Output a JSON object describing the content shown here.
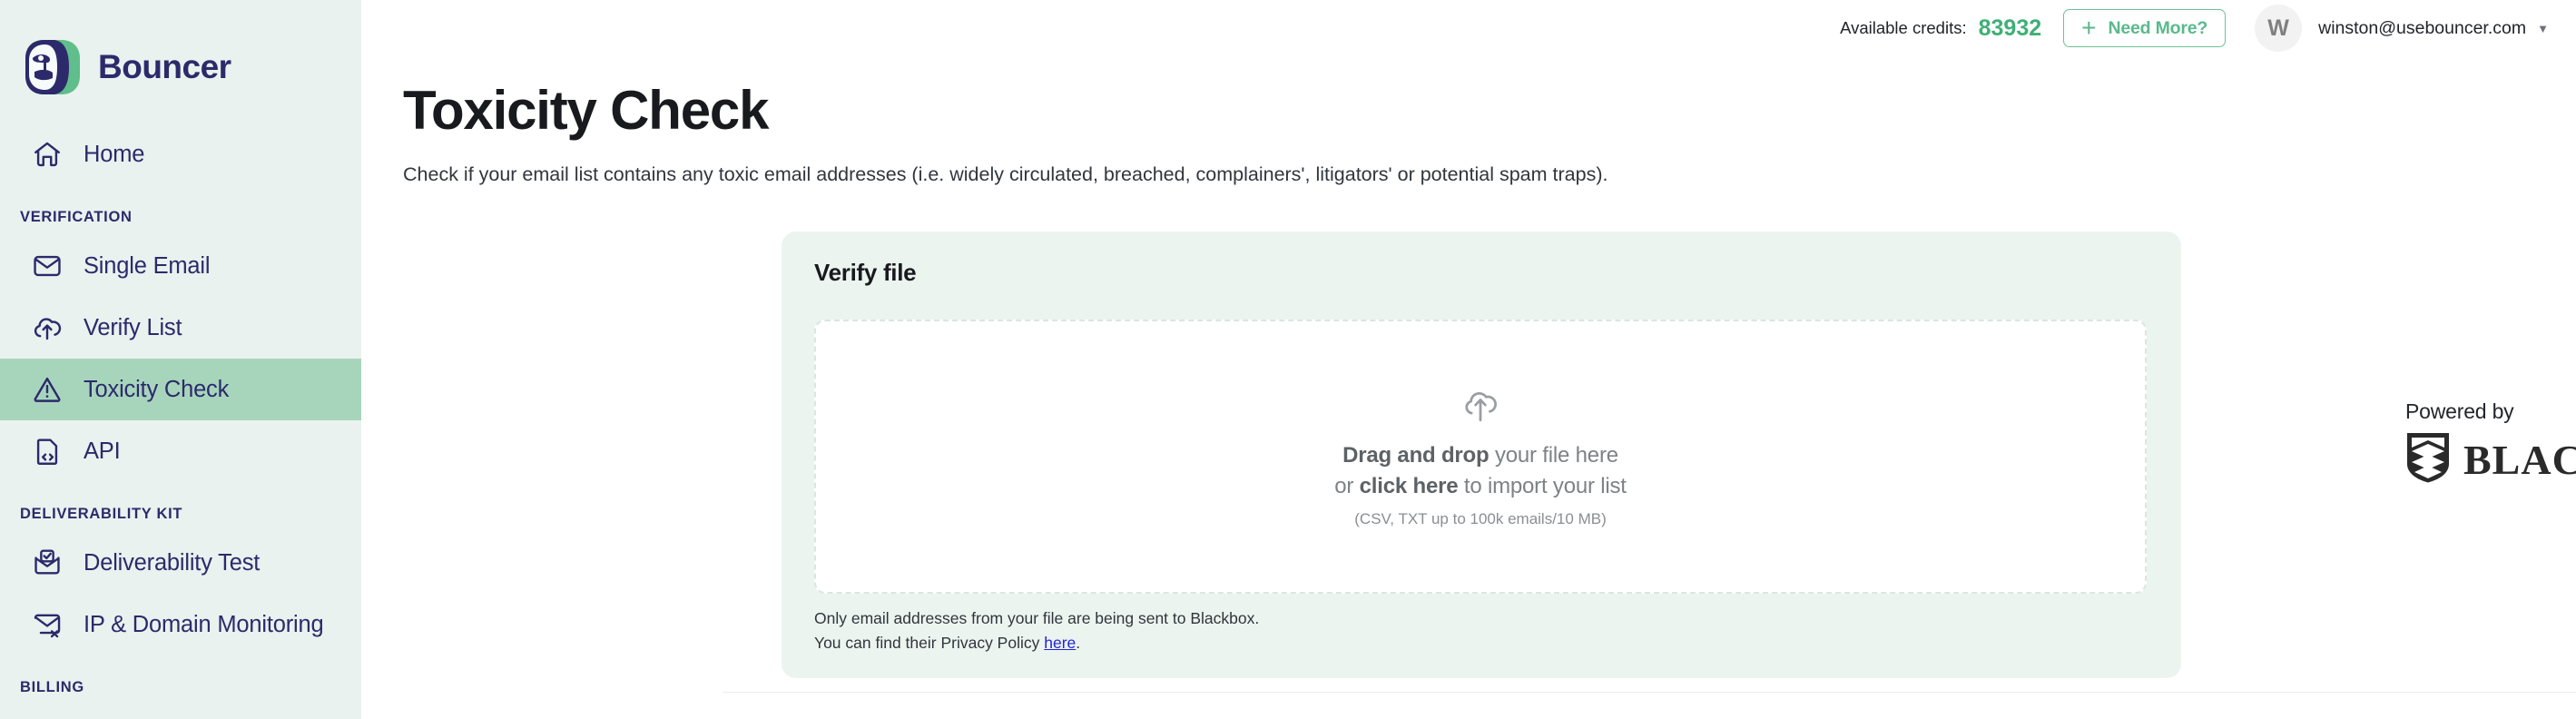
{
  "brand": {
    "name": "Bouncer",
    "logo_icon": "bouncer-gorilla-logo"
  },
  "sidebar": {
    "groups": [
      {
        "label": "",
        "items": [
          {
            "label": "Home",
            "icon": "home-icon",
            "active": false
          }
        ]
      },
      {
        "label": "VERIFICATION",
        "items": [
          {
            "label": "Single Email",
            "icon": "envelope-icon",
            "active": false
          },
          {
            "label": "Verify List",
            "icon": "cloud-upload-icon",
            "active": false
          },
          {
            "label": "Toxicity Check",
            "icon": "warning-triangle-icon",
            "active": true
          },
          {
            "label": "API",
            "icon": "code-file-icon",
            "active": false
          }
        ]
      },
      {
        "label": "DELIVERABILITY KIT",
        "items": [
          {
            "label": "Deliverability Test",
            "icon": "envelope-check-icon",
            "active": false
          },
          {
            "label": "IP & Domain Monitoring",
            "icon": "envelope-x-icon",
            "active": false
          }
        ]
      },
      {
        "label": "BILLING",
        "items": []
      }
    ]
  },
  "topbar": {
    "credits_label": "Available credits:",
    "credits_value": "83932",
    "need_more_label": "Need More?",
    "need_more_icon": "plus-icon",
    "avatar_initial": "W",
    "account_email": "winston@usebouncer.com",
    "caret_icon": "chevron-down-icon"
  },
  "page": {
    "title": "Toxicity Check",
    "subtitle": "Check if your email list contains any toxic email addresses (i.e. widely circulated, breached, complainers', litigators' or potential spam traps)."
  },
  "card": {
    "title": "Verify file",
    "dropzone": {
      "icon": "cloud-upload-icon",
      "line1_bold": "Drag and drop",
      "line1_rest": " your file here",
      "line2_prefix": "or ",
      "line2_bold": "click here",
      "line2_rest": " to import your list",
      "hint": "(CSV, TXT up to 100k emails/10 MB)"
    },
    "note_line1": "Only email addresses from your file are being sent to Blackbox.",
    "note_line2_prefix": "You can find their Privacy Policy ",
    "note_link": "here",
    "note_line2_suffix": "."
  },
  "powered_by": {
    "label": "Powered by",
    "logo_icon": "blackbox-shield-icon",
    "word": "BLACKBOX"
  },
  "colors": {
    "sidebar_bg": "#E9F2EE",
    "active_item_bg": "#A7D5BC",
    "brand_navy": "#2C2A6B",
    "accent_green": "#5BB98C",
    "credits_green": "#3FAF76",
    "card_bg": "#ECF4F0",
    "link_blue": "#2222DD"
  }
}
